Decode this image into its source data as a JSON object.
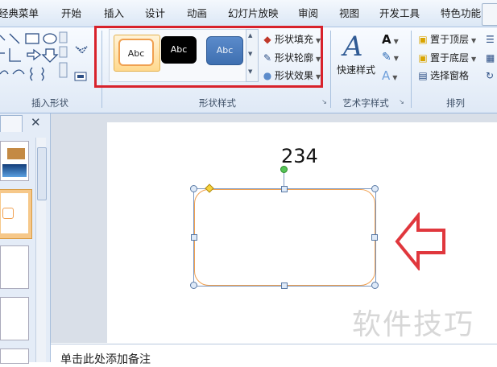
{
  "tabs": [
    "经典菜单",
    "开始",
    "插入",
    "设计",
    "动画",
    "幻灯片放映",
    "审阅",
    "视图",
    "开发工具",
    "特色功能"
  ],
  "ribbon": {
    "insert_shapes": {
      "label": "插入形状"
    },
    "shape_styles": {
      "label": "形状样式",
      "samples": [
        {
          "text": "Abc",
          "style": "white-orange",
          "selected": true
        },
        {
          "text": "Abc",
          "style": "black"
        },
        {
          "text": "Abc",
          "style": "blue"
        }
      ],
      "fill": "形状填充",
      "outline": "形状轮廓",
      "effects": "形状效果"
    },
    "wordart": {
      "label": "艺术字样式",
      "quick_styles": "快速样式"
    },
    "arrange": {
      "label": "排列",
      "bring_forward": "置于顶层",
      "send_backward": "置于底层",
      "selection_pane": "选择窗格"
    }
  },
  "slide": {
    "text": "234"
  },
  "notes": {
    "placeholder": "单击此处添加备注"
  },
  "watermark": "软件技巧",
  "colors": {
    "highlight": "#d8222b",
    "shape_outline": "#f0a050",
    "arrow": "#e0373d",
    "ribbon_border": "#9db8dc"
  }
}
